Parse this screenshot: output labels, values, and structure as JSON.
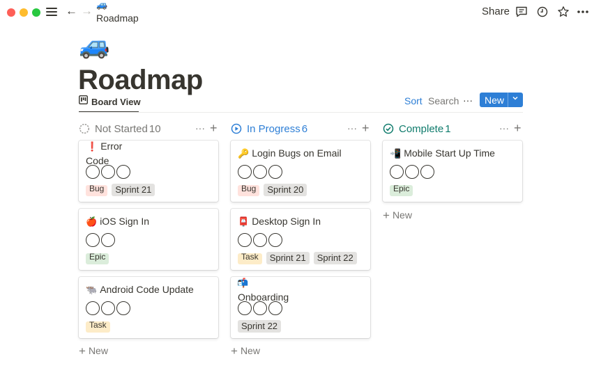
{
  "window": {
    "breadcrumb_emoji": "🚙",
    "breadcrumb_label": "Roadmap",
    "share_label": "Share"
  },
  "page": {
    "emoji": "🚙",
    "title": "Roadmap"
  },
  "view": {
    "tab_label": "Board View",
    "sort_label": "Sort",
    "search_label": "Search",
    "more_label": "···",
    "new_label": "New",
    "new_caret": "⌄"
  },
  "colors": {
    "accent": "#2e7fd6",
    "not_started": "#787774",
    "in_progress": "#2e7fd6",
    "complete": "#0f7b6c"
  },
  "columns": [
    {
      "title": "Not Started",
      "count": "10",
      "icon": "dotted-circle-icon",
      "new_label": "New",
      "cards": [
        {
          "emoji": "❗",
          "title": "Error Code",
          "tags": [
            {
              "label": "Bug",
              "cut": true,
              "kind": "bug"
            },
            {
              "label": "Sprint 21",
              "kind": "sprint"
            }
          ]
        },
        {
          "emoji": "🍎",
          "title": "iOS Sign In",
          "tags": [
            {
              "label": "Epic",
              "cut": true,
              "kind": "epic"
            }
          ]
        },
        {
          "emoji": "🐃",
          "title": "Android Code Update",
          "tags": [
            {
              "label": "Task",
              "cut": true,
              "kind": "task"
            }
          ]
        }
      ]
    },
    {
      "title": "In Progress",
      "count": "6",
      "icon": "play-circle-icon",
      "new_label": "New",
      "cards": [
        {
          "emoji": "🔑",
          "title": "Login Bugs on Email",
          "tags": [
            {
              "label": "Bug",
              "cut": true,
              "kind": "bug"
            },
            {
              "label": "Sprint 20",
              "kind": "sprint"
            }
          ]
        },
        {
          "emoji": "📮",
          "title": "Desktop Sign In",
          "tags": [
            {
              "label": "Task",
              "cut": true,
              "kind": "task"
            },
            {
              "label": "Sprint 21",
              "kind": "sprint"
            },
            {
              "label": "Sprint 22",
              "kind": "sprint"
            }
          ]
        },
        {
          "emoji": "📬",
          "title": "Onboarding",
          "tags": [
            {
              "label": "Sprint 22",
              "kind": "sprint"
            }
          ]
        }
      ]
    },
    {
      "title": "Complete",
      "count": "1",
      "icon": "check-circle-icon",
      "cards": [
        {
          "emoji": "📲",
          "title": "Mobile Start Up Time",
          "tags": [
            {
              "label": "Epic",
              "cut": true,
              "kind": "epic"
            }
          ]
        }
      ],
      "new_label": "New"
    }
  ]
}
